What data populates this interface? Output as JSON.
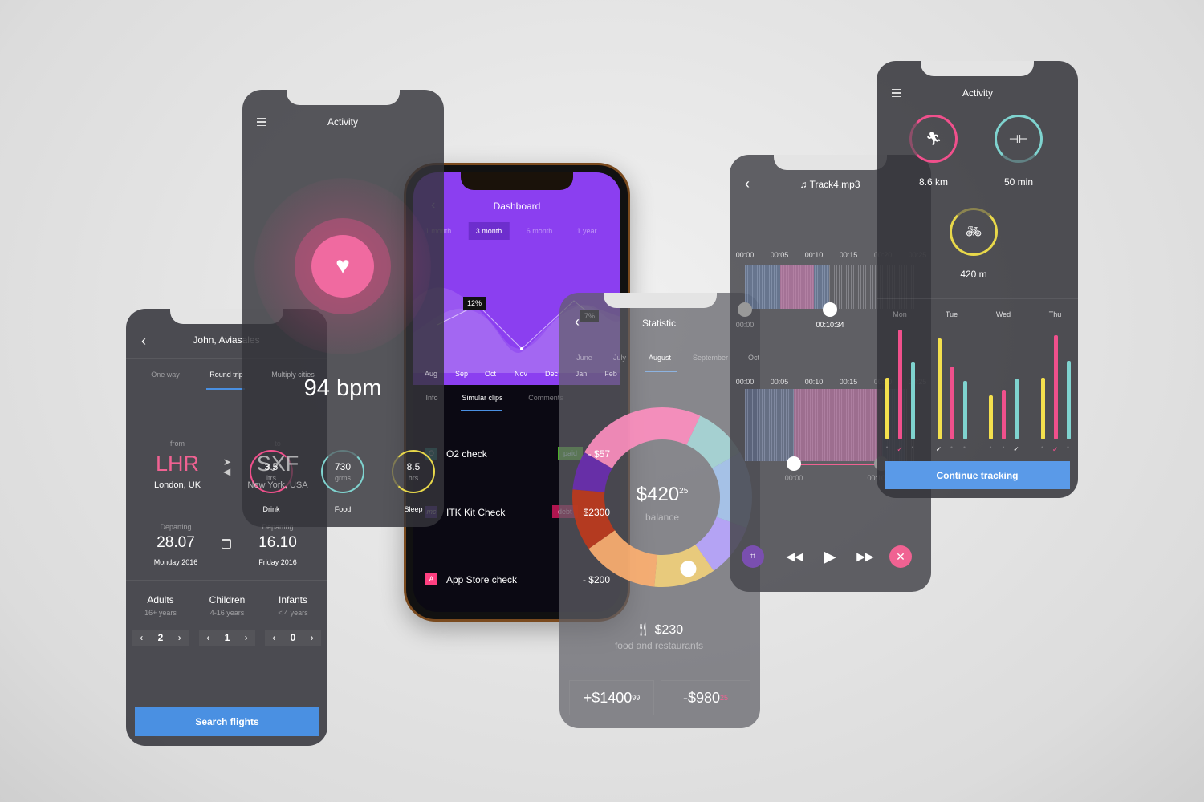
{
  "flight": {
    "title": "John, Aviasales",
    "tabs": [
      "One way",
      "Round trip",
      "Multiply cities"
    ],
    "active_tab": 1,
    "from_label": "from",
    "from_code": "LHR",
    "from_city": "London, UK",
    "to_label": "to",
    "to_code": "SXF",
    "to_city": "New York, USA",
    "depart": [
      {
        "label": "Departing",
        "date": "28.07",
        "day": "Monday 2016"
      },
      {
        "label": "Departing",
        "date": "16.10",
        "day": "Friday 2016"
      }
    ],
    "passengers": [
      {
        "label": "Adults",
        "sub": "16+ years",
        "count": "2"
      },
      {
        "label": "Children",
        "sub": "4-16 years",
        "count": "1"
      },
      {
        "label": "Infants",
        "sub": "< 4 years",
        "count": "0"
      }
    ],
    "search_label": "Search flights",
    "accent": "#4a90e2",
    "code_color": "#f06292"
  },
  "heart": {
    "title": "Activity",
    "bpm": "94 bpm",
    "stats": [
      {
        "value": "3.5",
        "unit": "ltrs",
        "label": "Drink",
        "color": "#f0508c"
      },
      {
        "value": "730",
        "unit": "grms",
        "label": "Food",
        "color": "#7fd3cf"
      },
      {
        "value": "8.5",
        "unit": "hrs",
        "label": "Sleep",
        "color": "#e8d84a"
      }
    ]
  },
  "dashboard": {
    "title": "Dashboard",
    "ranges": [
      "1 month",
      "3 month",
      "6 month",
      "1 year"
    ],
    "active_range": 1,
    "months": [
      "Aug",
      "Sep",
      "Oct",
      "Nov",
      "Dec",
      "Jan",
      "Feb"
    ],
    "tooltips": [
      "12%",
      "7%"
    ],
    "tabs": [
      "Info",
      "Simular clips",
      "Comments"
    ],
    "active_tab": 1,
    "rows": [
      {
        "name": "O2 check",
        "badge": "paid",
        "badge_color": "#4caf2a",
        "amount": "- $57",
        "icon_color": "#2a9d8f",
        "icon": "O"
      },
      {
        "name": "ITK Kit Check",
        "badge": "debt",
        "badge_color": "#e91e63",
        "amount": "$2300",
        "icon_color": "#5e35b1",
        "icon": "mc"
      },
      {
        "name": "App Store check",
        "badge": "",
        "amount": "- $200",
        "icon_color": "#ff4081",
        "icon": "A"
      }
    ],
    "purple": "#8b3ff0"
  },
  "statistic": {
    "title": "Statistic",
    "months": [
      "June",
      "July",
      "August",
      "September",
      "Oct"
    ],
    "active_month": 2,
    "balance_main": "$420",
    "balance_cents": "25",
    "balance_label": "balance",
    "category_amount": "$230",
    "category_label": "food and restaurants",
    "income": "+$1400",
    "income_cents": "99",
    "expense": "-$980",
    "expense_cents": "25"
  },
  "music": {
    "title": "Track4.mp3",
    "ticks": [
      "00:00",
      "00:05",
      "00:10",
      "00:15",
      "00:20",
      "00:25"
    ],
    "start": "00:00",
    "pos": "00:10:34",
    "start2": "00:00",
    "pos2": "00:10:34"
  },
  "activity": {
    "title": "Activity",
    "rings": [
      {
        "label": "8.6 km",
        "color": "#f0508c",
        "icon": "run"
      },
      {
        "label": "50 min",
        "color": "#7fd3cf",
        "icon": "dumbbell"
      },
      {
        "label": "420 m",
        "color": "#e8d84a",
        "icon": "bike"
      }
    ],
    "days": [
      {
        "label": "Mon",
        "bars": [
          55,
          98,
          69
        ],
        "check": 1
      },
      {
        "label": "Tue",
        "bars": [
          90,
          65,
          52
        ],
        "check": 0
      },
      {
        "label": "Wed",
        "bars": [
          39,
          44,
          54
        ],
        "check": 2
      },
      {
        "label": "Thu",
        "bars": [
          55,
          93,
          70
        ],
        "check": 1
      }
    ],
    "bar_colors": [
      "#f4e04d",
      "#f0508c",
      "#7fd3cf"
    ],
    "continue_label": "Continue tracking"
  }
}
